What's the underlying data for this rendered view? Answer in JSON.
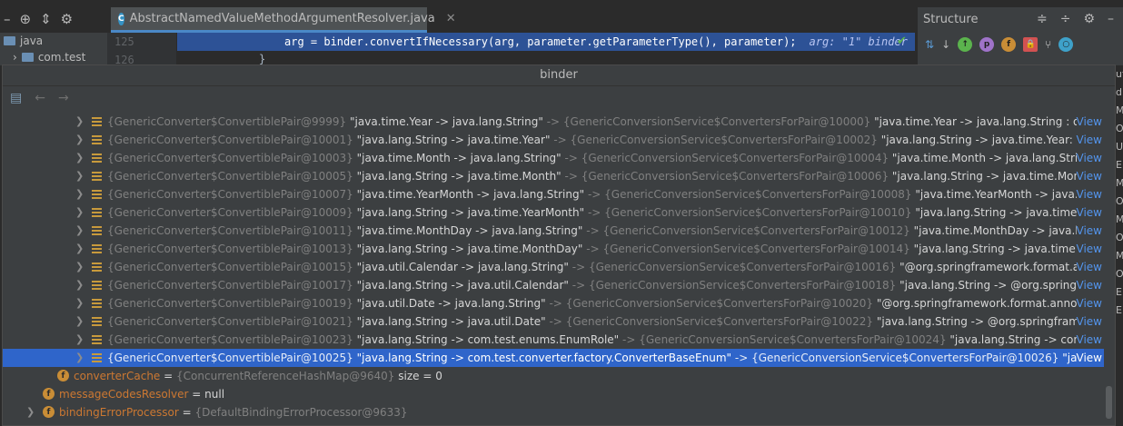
{
  "editor": {
    "tab_title": "AbstractNamedValueMethodArgumentResolver.java",
    "tab_icon_letter": "C",
    "project": {
      "root": "java",
      "child": "com.test"
    },
    "line_numbers": [
      "125",
      "126"
    ],
    "code": "arg = binder.convertIfNecessary(arg, parameter.getParameterType(), parameter);",
    "inline_hint": "arg: \"1\"  binder",
    "next_line": "}"
  },
  "structure": {
    "title": "Structure"
  },
  "popup": {
    "title": "binder",
    "rows": [
      {
        "pair": "{GenericConverter$ConvertiblePair@9999}",
        "key": "\"java.time.Year -> java.lang.String\"",
        "arrow": "->",
        "cfp": "{GenericConversionService$ConvertersForPair@10000}",
        "value": "\"java.time.Year -> java.lang.String : org.springfra",
        "link": "View"
      },
      {
        "pair": "{GenericConverter$ConvertiblePair@10001}",
        "key": "\"java.lang.String -> java.time.Year\"",
        "arrow": "->",
        "cfp": "{GenericConversionService$ConvertersForPair@10002}",
        "value": "\"java.lang.String -> java.time.Year: org.springfra",
        "link": "View"
      },
      {
        "pair": "{GenericConverter$ConvertiblePair@10003}",
        "key": "\"java.time.Month -> java.lang.String\"",
        "arrow": "->",
        "cfp": "{GenericConversionService$ConvertersForPair@10004}",
        "value": "\"java.time.Month -> java.lang.String : org.spri",
        "link": "View"
      },
      {
        "pair": "{GenericConverter$ConvertiblePair@10005}",
        "key": "\"java.lang.String -> java.time.Month\"",
        "arrow": "->",
        "cfp": "{GenericConversionService$ConvertersForPair@10006}",
        "value": "\"java.lang.String -> java.time.Month: org.spri",
        "link": "View"
      },
      {
        "pair": "{GenericConverter$ConvertiblePair@10007}",
        "key": "\"java.time.YearMonth -> java.lang.String\"",
        "arrow": "->",
        "cfp": "{GenericConversionService$ConvertersForPair@10008}",
        "value": "\"java.time.YearMonth -> java.lang.String",
        "link": "View"
      },
      {
        "pair": "{GenericConverter$ConvertiblePair@10009}",
        "key": "\"java.lang.String -> java.time.YearMonth\"",
        "arrow": "->",
        "cfp": "{GenericConversionService$ConvertersForPair@10010}",
        "value": "\"java.lang.String -> java.time.YearMonth",
        "link": "View"
      },
      {
        "pair": "{GenericConverter$ConvertiblePair@10011}",
        "key": "\"java.time.MonthDay -> java.lang.String\"",
        "arrow": "->",
        "cfp": "{GenericConversionService$ConvertersForPair@10012}",
        "value": "\"java.time.MonthDay -> java.lang.String :",
        "link": "View"
      },
      {
        "pair": "{GenericConverter$ConvertiblePair@10013}",
        "key": "\"java.lang.String -> java.time.MonthDay\"",
        "arrow": "->",
        "cfp": "{GenericConversionService$ConvertersForPair@10014}",
        "value": "\"java.lang.String -> java.time.MonthDay:",
        "link": "View"
      },
      {
        "pair": "{GenericConverter$ConvertiblePair@10015}",
        "key": "\"java.util.Calendar -> java.lang.String\"",
        "arrow": "->",
        "cfp": "{GenericConversionService$ConvertersForPair@10016}",
        "value": "\"@org.springframework.format.annotation.I",
        "link": "View"
      },
      {
        "pair": "{GenericConverter$ConvertiblePair@10017}",
        "key": "\"java.lang.String -> java.util.Calendar\"",
        "arrow": "->",
        "cfp": "{GenericConversionService$ConvertersForPair@10018}",
        "value": "\"java.lang.String -> @org.springframework.",
        "link": "View"
      },
      {
        "pair": "{GenericConverter$ConvertiblePair@10019}",
        "key": "\"java.util.Date -> java.lang.String\"",
        "arrow": "->",
        "cfp": "{GenericConversionService$ConvertersForPair@10020}",
        "value": "\"@org.springframework.format.annotation.Date",
        "link": "View"
      },
      {
        "pair": "{GenericConverter$ConvertiblePair@10021}",
        "key": "\"java.lang.String -> java.util.Date\"",
        "arrow": "->",
        "cfp": "{GenericConversionService$ConvertersForPair@10022}",
        "value": "\"java.lang.String -> @org.springframework.form",
        "link": "View"
      },
      {
        "pair": "{GenericConverter$ConvertiblePair@10023}",
        "key": "\"java.lang.String -> com.test.enums.EnumRole\"",
        "arrow": "->",
        "cfp": "{GenericConversionService$ConvertersForPair@10024}",
        "value": "\"java.lang.String -> com.test.enum",
        "link": "View"
      },
      {
        "pair": "{GenericConverter$ConvertiblePair@10025}",
        "key": "\"java.lang.String -> com.test.converter.factory.ConverterBaseEnum\"",
        "arrow": "->",
        "cfp": "{GenericConversionService$ConvertersForPair@10026}",
        "value": "\"java.lang.Stri",
        "link": "View",
        "selected": true
      }
    ],
    "fields": [
      {
        "name": "converterCache",
        "eq": "=",
        "type": "{ConcurrentReferenceHashMap@9640}",
        "extra": "size = 0"
      },
      {
        "name": "messageCodesResolver",
        "eq": "=",
        "type": "",
        "extra": "null"
      },
      {
        "name": "bindingErrorProcessor",
        "eq": "=",
        "type": "{DefaultBindingErrorProcessor@9633}",
        "extra": ""
      }
    ]
  },
  "right_edge_letters": [
    "ut",
    "d",
    "M",
    "O",
    "U",
    "E",
    "M",
    "O",
    "M",
    "O",
    "M",
    "O",
    "E",
    "E"
  ]
}
